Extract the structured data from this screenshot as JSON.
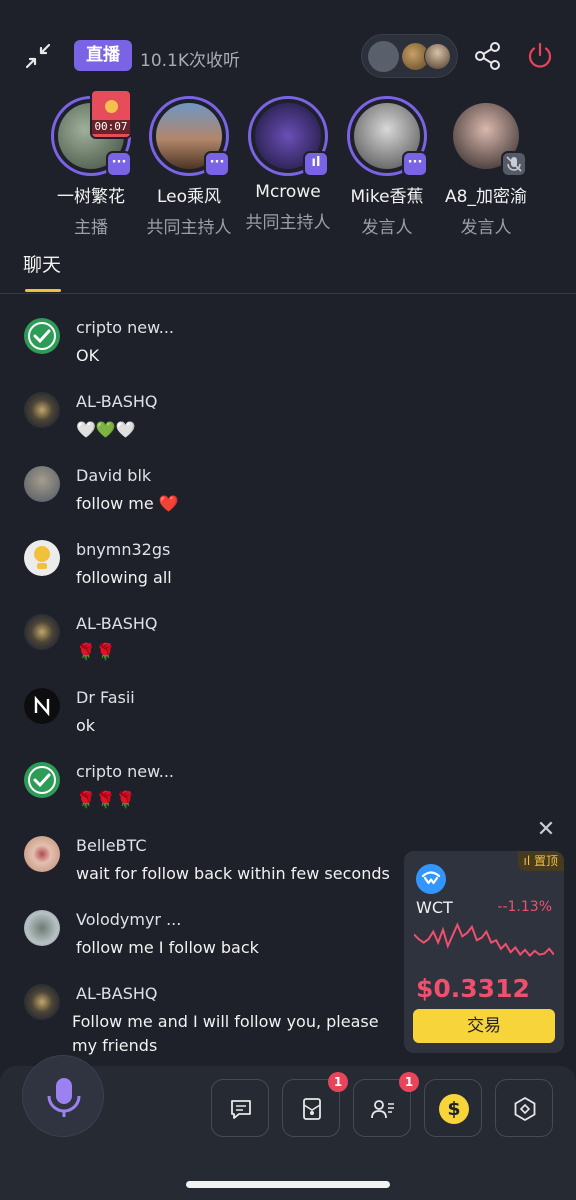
{
  "header": {
    "live_label": "直播",
    "listeners": "10.1K次收听"
  },
  "speakers": [
    {
      "name": "一树繁花",
      "role": "主播",
      "badge": "···",
      "timer": "00:07"
    },
    {
      "name": "Leo乘风",
      "role": "共同主持人",
      "badge": "···"
    },
    {
      "name": "Mcrowe",
      "role": "共同主持人",
      "badge": "ıl"
    },
    {
      "name": "Mike香蕉",
      "role": "发言人",
      "badge": "···"
    },
    {
      "name": "A8_加密渝",
      "role": "发言人",
      "badge": "muted-mic"
    }
  ],
  "tabs": {
    "chat": "聊天"
  },
  "chat": [
    {
      "user": "cripto new...",
      "text": "OK",
      "avatar": "check-icon"
    },
    {
      "user": "AL-BASHQ",
      "text": "🤍💚🤍",
      "avatar": "badge-avatar"
    },
    {
      "user": "David blk",
      "text": "follow me ❤️",
      "avatar": "photo-avatar"
    },
    {
      "user": "bnymn32gs",
      "text": "following all",
      "avatar": "yellow-avatar"
    },
    {
      "user": "AL-BASHQ",
      "text": "🌹🌹",
      "avatar": "badge-avatar"
    },
    {
      "user": "Dr Fasii",
      "text": "ok",
      "avatar": "n-logo-avatar"
    },
    {
      "user": "cripto new...",
      "text": "🌹🌹🌹",
      "avatar": "check-icon"
    },
    {
      "user": "BelleBTC",
      "text": "wait for follow back within few seconds",
      "avatar": "photo-avatar"
    },
    {
      "user": "Volodymyr ...",
      "text": "follow me I follow back",
      "avatar": "photo-avatar"
    },
    {
      "user": "AL-BASHQ",
      "text": "Follow me and I will follow you, please my friends",
      "avatar": "badge-avatar"
    }
  ],
  "token_card": {
    "pin_label": "置顶",
    "symbol": "WCT",
    "change": "--1.13%",
    "price": "$0.3312",
    "trade_label": "交易",
    "sparkline": [
      0.72,
      0.62,
      0.55,
      0.62,
      0.78,
      0.55,
      0.82,
      0.48,
      0.7,
      0.92,
      0.68,
      0.75,
      0.88,
      0.6,
      0.65,
      0.78,
      0.55,
      0.6,
      0.42,
      0.52,
      0.35,
      0.45,
      0.3,
      0.4,
      0.28,
      0.38,
      0.3,
      0.32,
      0.42,
      0.3
    ],
    "accent": "#f0506e"
  },
  "bottom": {
    "requests_badge": "1",
    "listeners_badge": "1",
    "coin_symbol": "$"
  },
  "colors": {
    "background": "#1e2129",
    "accent": "#7b63e6",
    "highlight": "#f2c13b",
    "danger": "#e8455a"
  }
}
